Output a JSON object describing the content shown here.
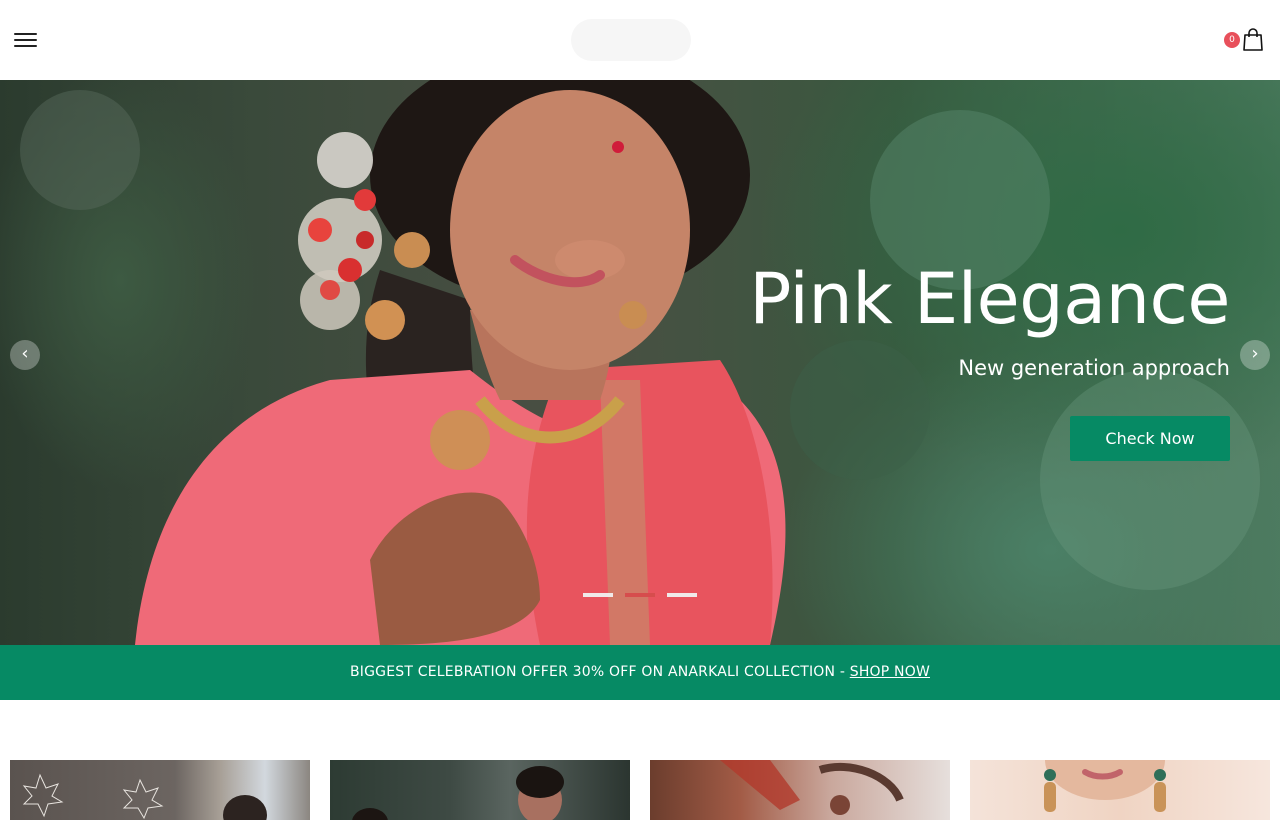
{
  "header": {
    "menu_icon": "hamburger-menu-icon",
    "cart": {
      "count": "0",
      "icon": "shopping-bag-icon"
    }
  },
  "hero": {
    "title": "Pink Elegance",
    "subtitle": "New generation approach",
    "cta_label": "Check Now",
    "prev_icon": "chevron-left-icon",
    "next_icon": "chevron-right-icon",
    "prev_glyph": "‹",
    "next_glyph": "›",
    "slides_total": 3,
    "active_slide": 2
  },
  "promo": {
    "text": "BIGGEST CELEBRATION OFFER 30% OFF ON ANARKALI COLLECTION - ",
    "link_label": "SHOP NOW"
  },
  "colors": {
    "brand_green": "#068a64",
    "badge_red": "#e8505b",
    "dot_active": "#d64d4d"
  }
}
